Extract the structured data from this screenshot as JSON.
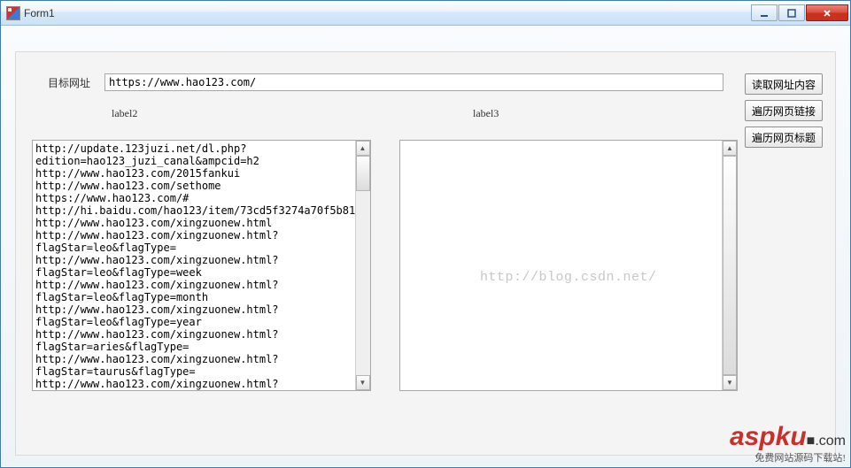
{
  "window": {
    "title": "Form1"
  },
  "labels": {
    "target_url": "目标网址",
    "placeholder1": "label2",
    "placeholder2": "label3"
  },
  "inputs": {
    "url_value": "https://www.hao123.com/"
  },
  "buttons": {
    "read_url": "读取网址内容",
    "traverse_links": "遍历网页链接",
    "traverse_titles": "遍历网页标题"
  },
  "textarea_left": "http://update.123juzi.net/dl.php?\nedition=hao123_juzi_canal&ampcid=h2\nhttp://www.hao123.com/2015fankui\nhttp://www.hao123.com/sethome\nhttps://www.hao123.com/#\nhttp://hi.baidu.com/hao123/item/73cd5f3274a70f5b81f1a788\nhttp://www.hao123.com/xingzuonew.html\nhttp://www.hao123.com/xingzuonew.html?\nflagStar=leo&flagType=\nhttp://www.hao123.com/xingzuonew.html?\nflagStar=leo&flagType=week\nhttp://www.hao123.com/xingzuonew.html?\nflagStar=leo&flagType=month\nhttp://www.hao123.com/xingzuonew.html?\nflagStar=leo&flagType=year\nhttp://www.hao123.com/xingzuonew.html?\nflagStar=aries&flagType=\nhttp://www.hao123.com/xingzuonew.html?\nflagStar=taurus&flagType=\nhttp://www.hao123.com/xingzuonew.html?\nflagStar=gemini&flagType=\nhttp://www.hao123.com/xingzuonew.html?\nflagStar=cancer&flagType=\nhttp://www.hao123.com/xingzuonew.html?",
  "textarea_right": "",
  "watermarks": {
    "blog": "http://blog.csdn.net/",
    "brand": "aspku",
    "domain_suffix": ".com",
    "tagline": "免费网站源码下载站!"
  }
}
